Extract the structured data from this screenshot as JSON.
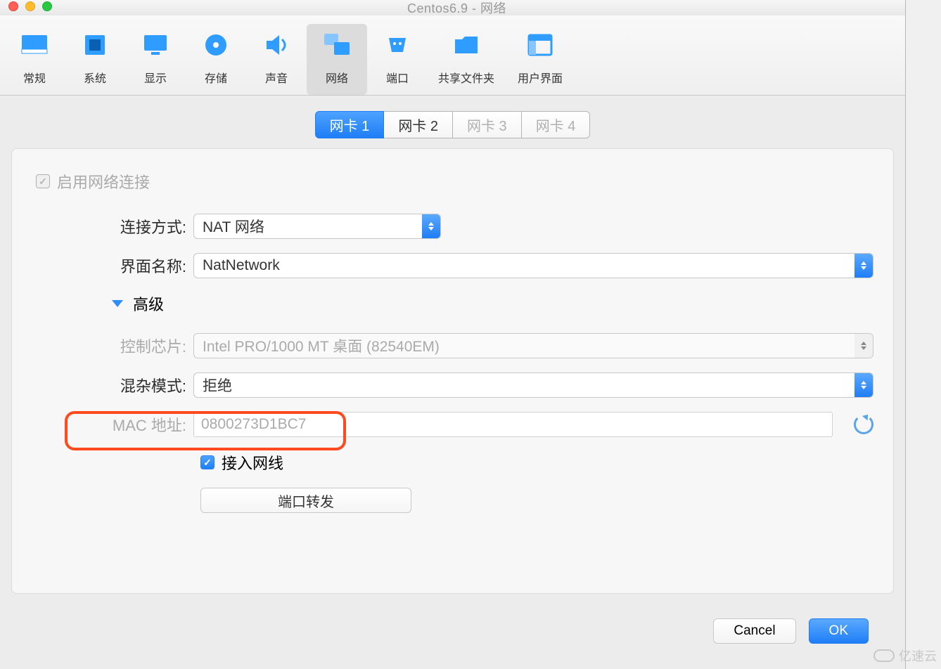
{
  "window": {
    "title": "Centos6.9 - 网络"
  },
  "toolbar": [
    {
      "label": "常规"
    },
    {
      "label": "系统"
    },
    {
      "label": "显示"
    },
    {
      "label": "存储"
    },
    {
      "label": "声音"
    },
    {
      "label": "网络",
      "active": true
    },
    {
      "label": "端口"
    },
    {
      "label": "共享文件夹"
    },
    {
      "label": "用户界面"
    }
  ],
  "tabs": [
    {
      "label": "网卡 1",
      "active": true
    },
    {
      "label": "网卡 2"
    },
    {
      "label": "网卡 3",
      "disabled": true
    },
    {
      "label": "网卡 4",
      "disabled": true
    }
  ],
  "form": {
    "enable_label": "启用网络连接",
    "attached_label": "连接方式:",
    "attached_value": "NAT 网络",
    "name_label": "界面名称:",
    "name_value": "NatNetwork",
    "advanced_label": "高级",
    "adapter_label": "控制芯片:",
    "adapter_value": "Intel PRO/1000 MT 桌面 (82540EM)",
    "promiscuous_label": "混杂模式:",
    "promiscuous_value": "拒绝",
    "mac_label": "MAC 地址:",
    "mac_value": "0800273D1BC7",
    "cable_label": "接入网线",
    "port_forward_label": "端口转发"
  },
  "buttons": {
    "cancel": "Cancel",
    "ok": "OK"
  },
  "watermark": "亿速云"
}
